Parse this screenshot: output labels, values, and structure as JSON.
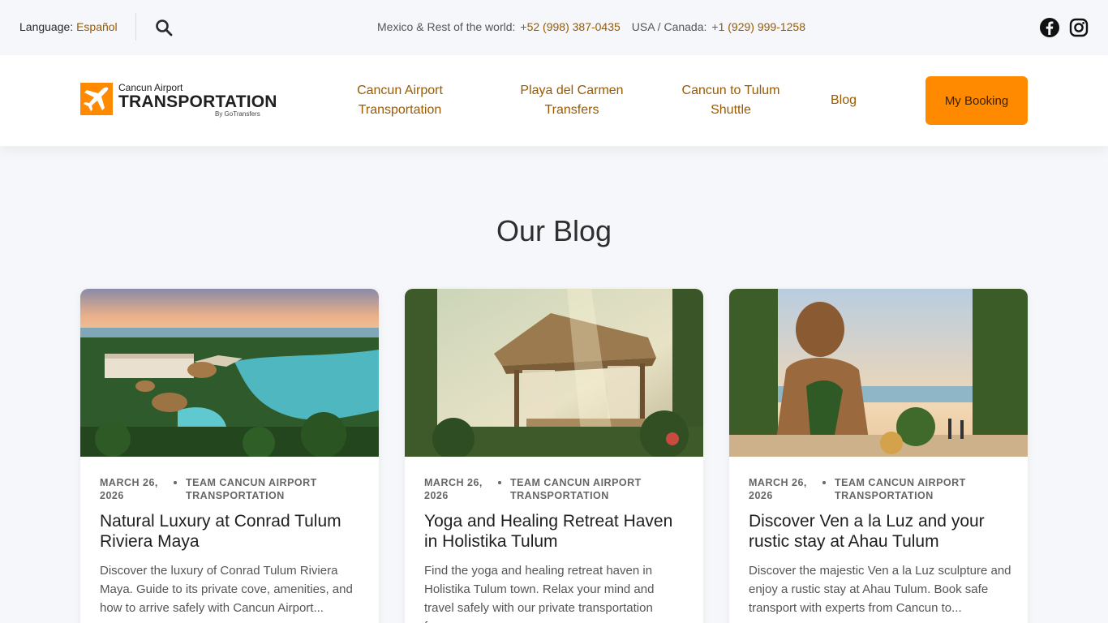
{
  "topbar": {
    "language_label": "Language:",
    "language_value": "Español",
    "mexico_label": "Mexico & Rest of the world:",
    "mexico_phone": "+52 (998) 387-0435",
    "usa_label": "USA / Canada:",
    "usa_phone": "+1 (929) 999-1258",
    "icons": [
      "search-icon",
      "facebook-icon",
      "instagram-icon"
    ]
  },
  "header": {
    "logo": {
      "small": "Cancun Airport",
      "big": "TRANSPORTATION",
      "by": "By GoTransfers"
    },
    "nav": [
      {
        "line1": "Cancun Airport",
        "line2": "Transportation"
      },
      {
        "line1": "Playa del Carmen",
        "line2": "Transfers"
      },
      {
        "line1": "Cancun to Tulum",
        "line2": "Shuttle"
      },
      {
        "line1": "Blog",
        "line2": ""
      }
    ],
    "booking_label": "My Booking"
  },
  "blog": {
    "title": "Our Blog",
    "posts": [
      {
        "date": "MARCH 26, 2026",
        "author": "TEAM CANCUN AIRPORT TRANSPORTATION",
        "title": "Natural Luxury at Conrad Tulum Riviera Maya",
        "excerpt": "Discover the luxury of Conrad Tulum Riviera Maya. Guide to its private cove, amenities, and how to arrive safely with Cancun Airport..."
      },
      {
        "date": "MARCH 26, 2026",
        "author": "TEAM CANCUN AIRPORT TRANSPORTATION",
        "title": "Yoga and Healing Retreat Haven in Holistika Tulum",
        "excerpt": "Find the yoga and healing retreat haven in Holistika Tulum town. Relax your mind and travel safely with our private transportation from..."
      },
      {
        "date": "MARCH 26, 2026",
        "author": "TEAM CANCUN AIRPORT TRANSPORTATION",
        "title": "Discover Ven a la Luz and your rustic stay at Ahau Tulum",
        "excerpt": "Discover the majestic Ven a la Luz sculpture and enjoy a rustic stay at Ahau Tulum. Book safe transport with experts from Cancun to..."
      }
    ]
  },
  "colors": {
    "accent": "#ff8a00",
    "link": "#9a5a00",
    "background": "#f5f7fa"
  }
}
